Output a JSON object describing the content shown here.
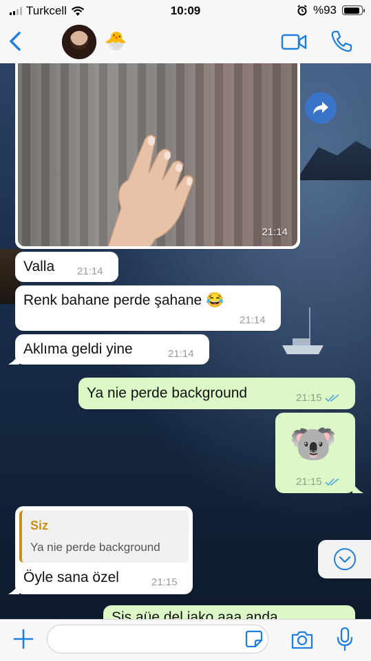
{
  "status_bar": {
    "carrier": "Turkcell",
    "time": "10:09",
    "battery": "%93",
    "battery_level": 0.93
  },
  "header": {
    "contact_emoji": "🐣"
  },
  "messages": [
    {
      "type": "image",
      "direction": "incoming",
      "time": "21:14"
    },
    {
      "type": "text",
      "direction": "incoming",
      "text": "Valla",
      "time": "21:14"
    },
    {
      "type": "text",
      "direction": "incoming",
      "text": "Renk bahane perde şahane 😂",
      "time": "21:14"
    },
    {
      "type": "text",
      "direction": "incoming",
      "text": "Aklıma geldi yine",
      "time": "21:14"
    },
    {
      "type": "text",
      "direction": "outgoing",
      "text": "Ya nie perde background",
      "time": "21:15",
      "status": "read"
    },
    {
      "type": "sticker",
      "direction": "outgoing",
      "text": "🐨",
      "time": "21:15",
      "status": "read"
    },
    {
      "type": "reply",
      "direction": "incoming",
      "quote_author": "Siz",
      "quote_text": "Ya nie perde background",
      "text": "Öyle sana özel",
      "time": "21:15"
    },
    {
      "type": "text",
      "direction": "outgoing",
      "text": "Sis aüe del iako aaa anda"
    }
  ],
  "composer": {
    "placeholder": ""
  },
  "icons": {
    "back": "chevron-left-icon",
    "video": "video-camera-icon",
    "call": "phone-icon",
    "forward": "forward-arrow-icon",
    "scroll": "chevron-down-icon",
    "attach": "plus-icon",
    "sticker": "sticker-icon",
    "camera": "camera-icon",
    "mic": "microphone-icon"
  },
  "colors": {
    "accent": "#1f7fe0",
    "outgoing_bubble": "#dcf8c6",
    "incoming_bubble": "#ffffff",
    "quote_author": "#c79117",
    "read_ticks": "#4fa3e3"
  }
}
